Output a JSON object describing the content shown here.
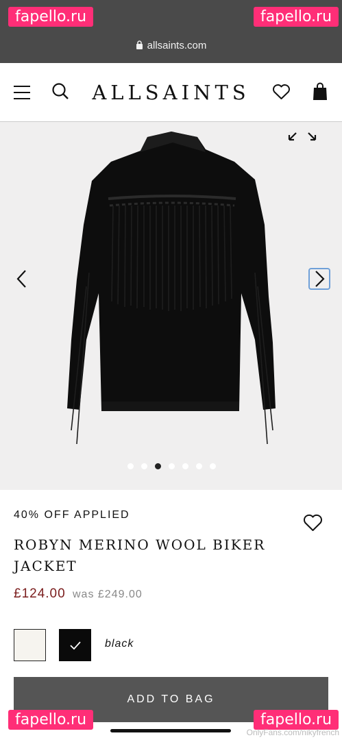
{
  "browser": {
    "url": "allsaints.com",
    "watermark": "fapello.ru"
  },
  "header": {
    "logo": "ALLSAINTS"
  },
  "gallery": {
    "image_alt": "Robyn merino wool biker jacket, back view",
    "dot_count": 7,
    "active_dot": 2
  },
  "product": {
    "badge": "40% OFF APPLIED",
    "title": "ROBYN MERINO WOOL BIKER JACKET",
    "price": "£124.00",
    "was_price": "was £249.00",
    "selected_color": "black",
    "add_to_bag": "ADD TO BAG"
  },
  "footer": {
    "credit": "OnlyFans.com/nikyfrench"
  },
  "colors": {
    "price": "#7a1c1c",
    "button": "#555555",
    "topbar": "#4a4a4a",
    "watermark": "#ff2e77"
  }
}
